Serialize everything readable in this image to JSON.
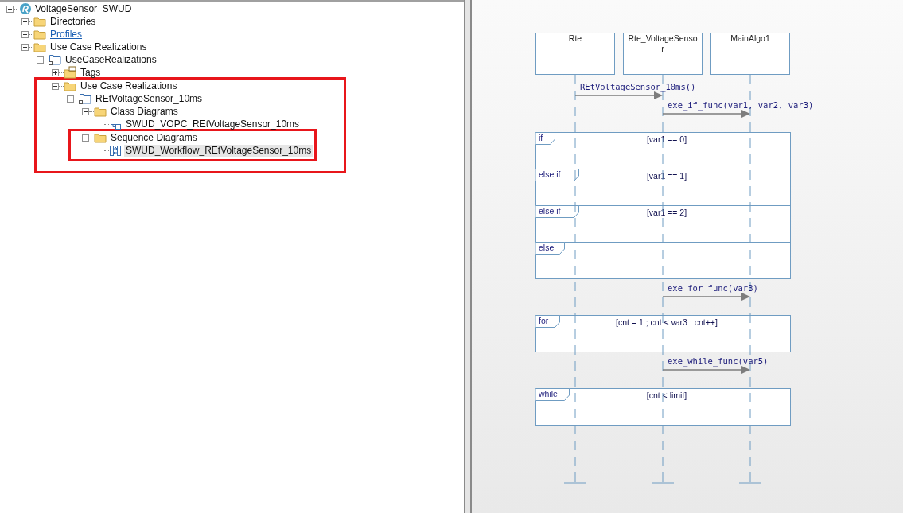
{
  "tree": [
    {
      "label": "VoltageSensor_SWUD",
      "kind": "project",
      "expanded": true,
      "selected": false,
      "children": [
        {
          "label": "Directories",
          "kind": "folder",
          "expanded": false,
          "selected": false
        },
        {
          "label": "Profiles",
          "kind": "link-folder",
          "expanded": false,
          "selected": false
        },
        {
          "label": "Use Case Realizations",
          "kind": "folder",
          "expanded": true,
          "selected": false,
          "children": [
            {
              "label": "UseCaseRealizations",
              "kind": "package",
              "expanded": true,
              "selected": false,
              "children": [
                {
                  "label": "Tags",
                  "kind": "tag-folder",
                  "expanded": false,
                  "selected": false
                },
                {
                  "label": "Use Case Realizations",
                  "kind": "folder",
                  "expanded": true,
                  "selected": false,
                  "boxed": true,
                  "children": [
                    {
                      "label": "REtVoltageSensor_10ms",
                      "kind": "package",
                      "expanded": true,
                      "selected": false,
                      "children": [
                        {
                          "label": "Class Diagrams",
                          "kind": "folder",
                          "expanded": true,
                          "selected": false,
                          "children": [
                            {
                              "label": "SWUD_VOPC_REtVoltageSensor_10ms",
                              "kind": "class-diagram",
                              "selected": false
                            }
                          ]
                        },
                        {
                          "label": "Sequence Diagrams",
                          "kind": "folder",
                          "expanded": true,
                          "selected": false,
                          "boxed": true,
                          "children": [
                            {
                              "label": "SWUD_Workflow_REtVoltageSensor_10ms",
                              "kind": "sequence-diagram",
                              "selected": true
                            }
                          ]
                        }
                      ]
                    }
                  ]
                }
              ]
            }
          ]
        }
      ]
    }
  ],
  "diagram": {
    "lifelines": [
      "Rte",
      "Rte_VoltageSensor",
      "MainAlgo1"
    ],
    "steps": [
      {
        "kind": "message",
        "label": "REtVoltageSensor_10ms()"
      },
      {
        "kind": "message",
        "label": "exe_if_func(var1, var2, var3)"
      },
      {
        "kind": "fragment",
        "operands": [
          {
            "operator": "if",
            "guard": "[var1 == 0]"
          },
          {
            "operator": "else if",
            "guard": "[var1 == 1]"
          },
          {
            "operator": "else if",
            "guard": "[var1 == 2]"
          },
          {
            "operator": "else"
          }
        ]
      },
      {
        "kind": "message",
        "label": "exe_for_func(var3)"
      },
      {
        "kind": "fragment",
        "operands": [
          {
            "operator": "for",
            "guard": "[cnt = 1 ; cnt < var3 ; cnt++]"
          }
        ]
      },
      {
        "kind": "message",
        "label": "exe_while_func(var5)"
      },
      {
        "kind": "fragment",
        "operands": [
          {
            "operator": "while",
            "guard": "[cnt < limit]"
          }
        ]
      }
    ]
  }
}
